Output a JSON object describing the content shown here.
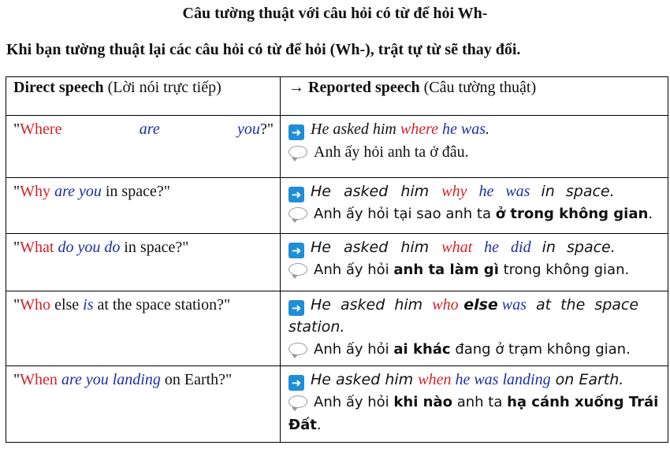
{
  "title": "Câu tường thuật với câu hỏi có từ để hỏi Wh-",
  "intro": "Khi bạn tường thuật lại các câu hỏi có từ để hỏi (Wh-), trật tự từ sẽ thay đổi.",
  "header": {
    "direct_bold": "Direct speech",
    "direct_rest": " (Lời nói trực tiếp)",
    "reported_arrow": "→ ",
    "reported_bold": "Reported speech",
    "reported_rest": " (Câu tường thuật)"
  },
  "rows": [
    {
      "q_open": "\"",
      "q_wh": "Where",
      "q_mid": "are",
      "q_end": "you",
      "q_close": "?\"",
      "r_a": "He asked him ",
      "r_wh": "where",
      "r_b": " he was",
      "r_c": ".",
      "vn": "Anh ấy hỏi anh ta ở đâu."
    },
    {
      "q_open": "\"",
      "q_wh": "Why",
      "q_mid": " are you",
      "q_rest": " in space?\"",
      "r_a": "He asked him ",
      "r_wh": "why",
      "r_b": " he was",
      "r_c": " in space.",
      "vn_a": "Anh ấy hỏi tại sao anh ta ",
      "vn_b": "ở trong không gian",
      "vn_c": "."
    },
    {
      "q_open": "\"",
      "q_wh": "What",
      "q_mid": " do you do",
      "q_rest": " in space?\"",
      "r_a": "He asked him ",
      "r_wh": "what",
      "r_b": " he did",
      "r_c": " in space.",
      "vn_a": "Anh ấy hỏi ",
      "vn_b": "anh ta làm gì",
      "vn_c": " trong không gian."
    },
    {
      "q_open": "\"",
      "q_wh": "Who",
      "q_else": " else ",
      "q_mid": "is",
      "q_rest": " at the space station?\"",
      "r_a": "He asked him ",
      "r_wh": "who",
      "r_else": " else",
      "r_b": " was",
      "r_c": " at the space station.",
      "vn_a": "Anh ấy hỏi ",
      "vn_b": "ai khác",
      "vn_c": " đang ở trạm không gian."
    },
    {
      "q_open": "\"",
      "q_wh": "When",
      "q_mid": " are you landing",
      "q_rest": " on Earth?\"",
      "r_a": "He asked him ",
      "r_wh": "when",
      "r_b": " he was landing",
      "r_c": " on Earth.",
      "vn_a": "Anh ấy hỏi ",
      "vn_b": "khi nào",
      "vn_c": " anh ta ",
      "vn_d": "hạ cánh xuống Trái Đất",
      "vn_e": "."
    }
  ],
  "icons": {
    "arrow": "right-arrow-icon",
    "bubble": "speech-bubble-icon"
  },
  "colors": {
    "wh": "#d2232a",
    "verb": "#1c2fa3",
    "arrow_bg": "#1e8fd6"
  }
}
